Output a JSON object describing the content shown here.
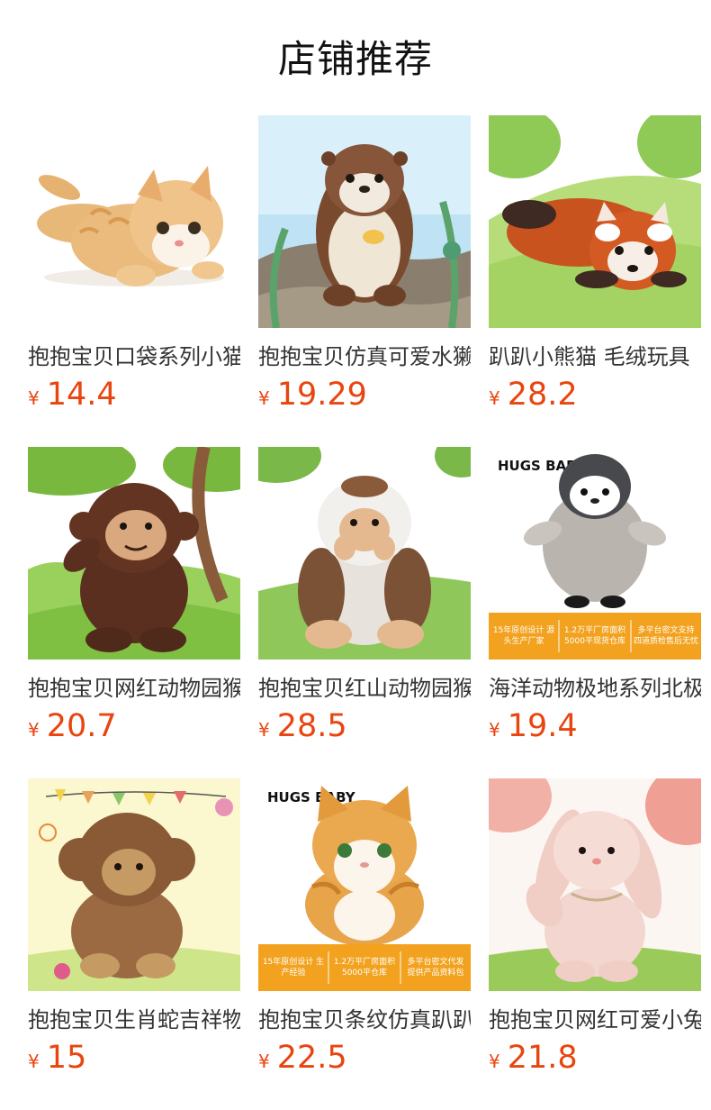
{
  "section": {
    "title": "店铺推荐"
  },
  "currency_symbol": "¥",
  "products": [
    {
      "name": "抱抱宝贝口袋系列小猫",
      "price": "14.4",
      "image_icon": "orange-tabby-cat-plush-icon"
    },
    {
      "name": "抱抱宝贝仿真可爱水獭",
      "price": "19.29",
      "image_icon": "otter-plush-icon"
    },
    {
      "name": "趴趴小熊猫 毛绒玩具",
      "price": "28.2",
      "image_icon": "red-panda-plush-icon"
    },
    {
      "name": "抱抱宝贝网红动物园猴",
      "price": "20.7",
      "image_icon": "brown-monkey-plush-icon"
    },
    {
      "name": "抱抱宝贝红山动物园猴",
      "price": "28.5",
      "image_icon": "macaque-plush-icon"
    },
    {
      "name": "海洋动物极地系列北极",
      "price": "19.4",
      "image_icon": "penguin-plush-icon",
      "brand": "HUGS BABY",
      "banner": [
        "15年原创设计 源头生产厂家",
        "1.2万平厂房面积 5000平现货仓库",
        "多平台密文支持 四道质检售后无忧"
      ]
    },
    {
      "name": "抱抱宝贝生肖蛇吉祥物",
      "price": "15",
      "image_icon": "teddy-monkey-plush-icon"
    },
    {
      "name": "抱抱宝贝条纹仿真趴趴",
      "price": "22.5",
      "image_icon": "sitting-cat-plush-icon",
      "brand": "HUGS BABY",
      "banner": [
        "15年原创设计 生产经验",
        "1.2万平厂房面积 5000平仓库",
        "多平台密文代发 提供产品资料包"
      ]
    },
    {
      "name": "抱抱宝贝网红可爱小兔",
      "price": "21.8",
      "image_icon": "pink-bunny-plush-icon"
    }
  ]
}
